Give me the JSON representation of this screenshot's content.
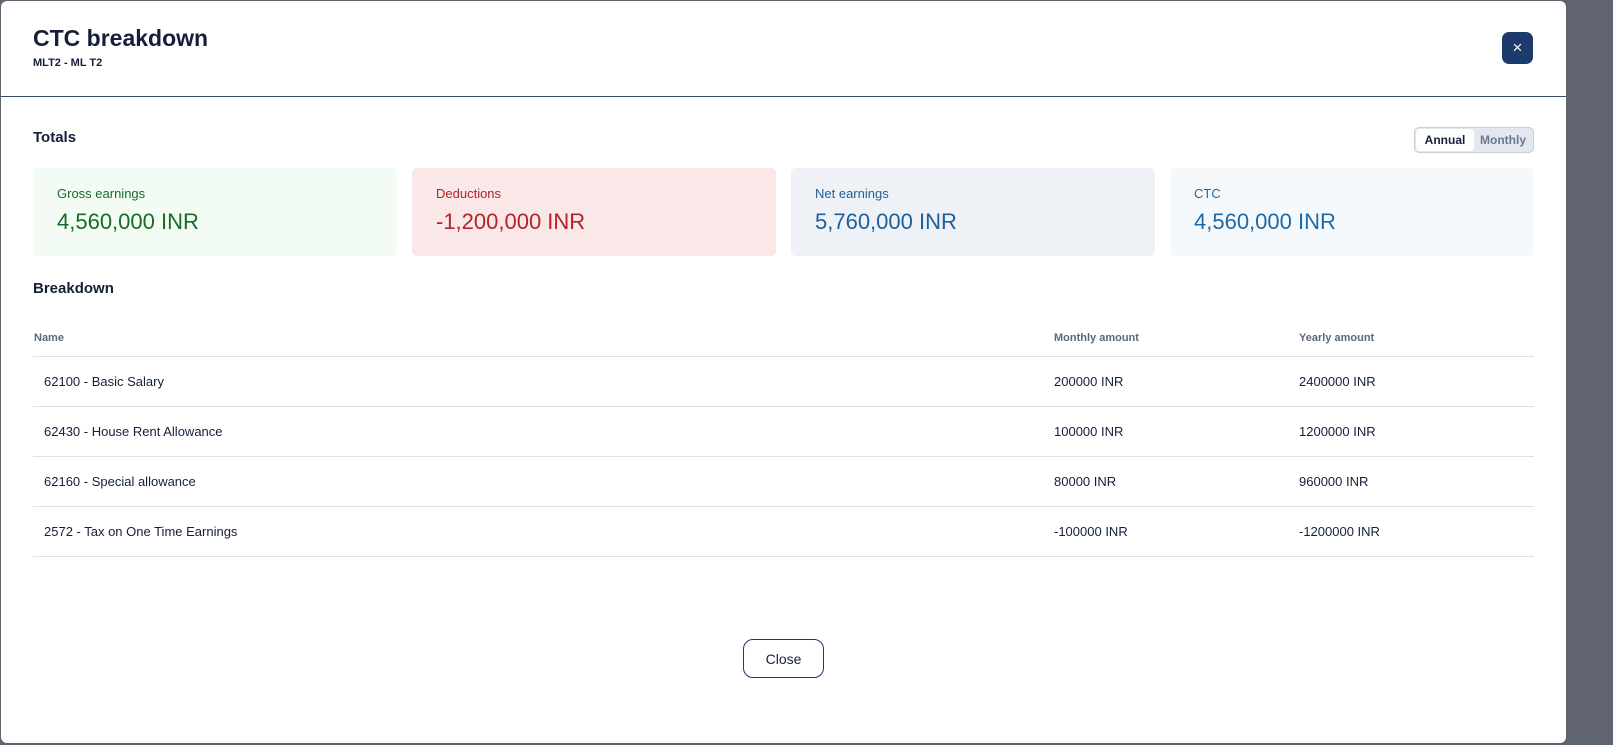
{
  "modal": {
    "title": "CTC breakdown",
    "subtitle": "MLT2 - ML T2",
    "close_icon": "×"
  },
  "totals": {
    "heading": "Totals",
    "period_toggle": {
      "annual": "Annual",
      "monthly": "Monthly",
      "selected": "Annual"
    },
    "cards": {
      "gross": {
        "label": "Gross earnings",
        "value": "4,560,000 INR",
        "color": "#1a6b23"
      },
      "deductions": {
        "label": "Deductions",
        "value": "-1,200,000 INR",
        "color": "#b32328"
      },
      "net": {
        "label": "Net earnings",
        "value": "5,760,000 INR",
        "color": "#1e5f9a"
      },
      "ctc": {
        "label": "CTC",
        "value": "4,560,000 INR",
        "color": "#1e6aa6"
      }
    }
  },
  "breakdown": {
    "heading": "Breakdown",
    "columns": {
      "name": "Name",
      "monthly": "Monthly amount",
      "yearly": "Yearly amount"
    },
    "rows": [
      {
        "name": "62100 - Basic Salary",
        "monthly": "200000 INR",
        "yearly": "2400000 INR"
      },
      {
        "name": "62430 - House Rent Allowance",
        "monthly": "100000 INR",
        "yearly": "1200000 INR"
      },
      {
        "name": "62160 - Special allowance",
        "monthly": "80000 INR",
        "yearly": "960000 INR"
      },
      {
        "name": "2572 - Tax on One Time Earnings",
        "monthly": "-100000 INR",
        "yearly": "-1200000 INR"
      }
    ]
  },
  "footer": {
    "close_label": "Close"
  },
  "colors": {
    "accent": "#1c3a6b"
  }
}
